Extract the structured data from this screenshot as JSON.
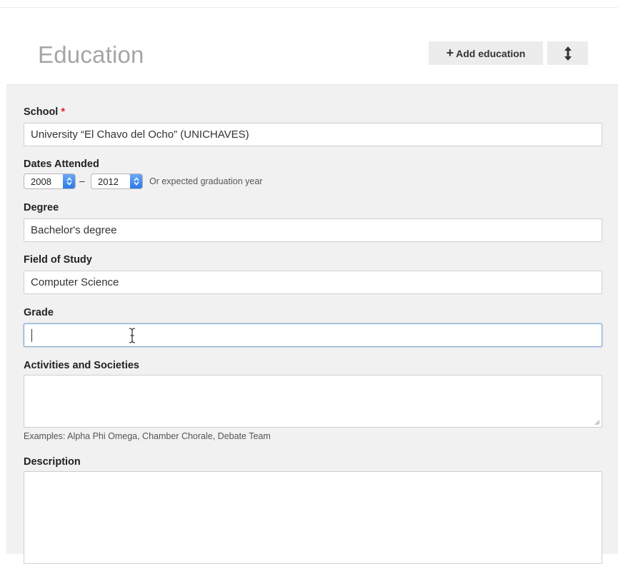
{
  "section": {
    "title": "Education",
    "add_button_label": "Add education",
    "add_icon": "plus-icon",
    "reorder_icon": "up-down-arrow-icon"
  },
  "form": {
    "school": {
      "label": "School",
      "required_mark": "*",
      "value": "University “El Chavo del Ocho” (UNICHAVES)"
    },
    "dates": {
      "label": "Dates Attended",
      "start_year": "2008",
      "separator": "–",
      "end_year": "2012",
      "hint": "Or expected graduation year"
    },
    "degree": {
      "label": "Degree",
      "value": "Bachelor's degree"
    },
    "field_of_study": {
      "label": "Field of Study",
      "value": "Computer Science"
    },
    "grade": {
      "label": "Grade",
      "value": ""
    },
    "activities": {
      "label": "Activities and Societies",
      "value": "",
      "hint": "Examples: Alpha Phi Omega, Chamber Chorale, Debate Team"
    },
    "description": {
      "label": "Description",
      "value": ""
    }
  },
  "colors": {
    "title_gray": "#a6a6a6",
    "form_background": "#f1f1f1",
    "required_red": "#dd2222",
    "focus_blue": "#7da7cf",
    "spinner_blue": "#2d78e8"
  }
}
